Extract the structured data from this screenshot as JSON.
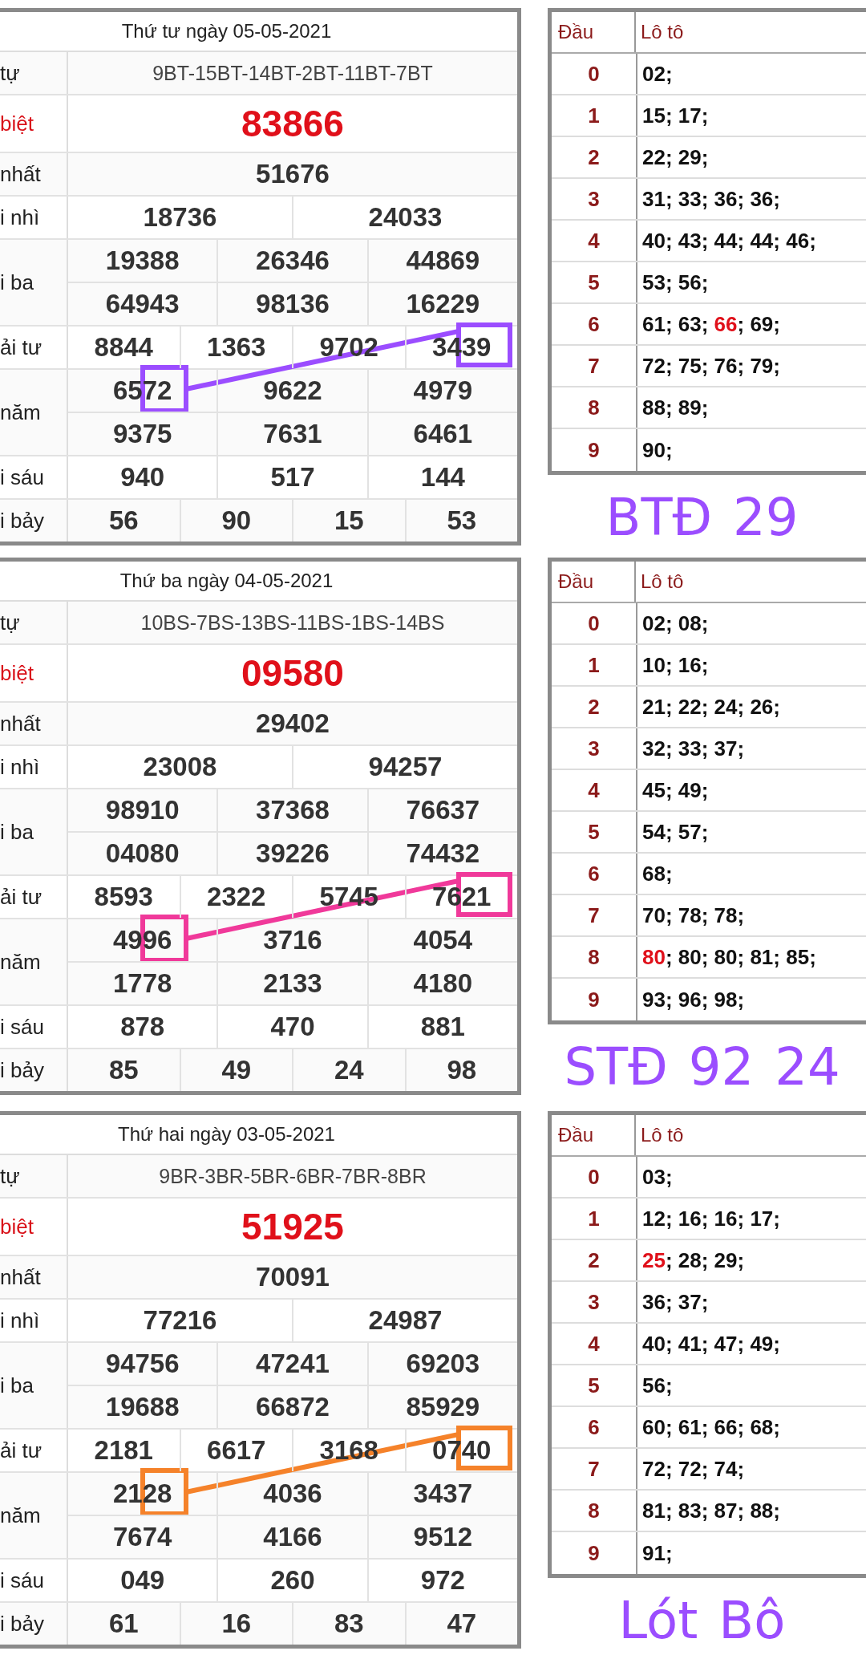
{
  "draws": [
    {
      "title": "Thứ tư ngày 05-05-2021",
      "notes": [
        "BTĐ",
        "29"
      ],
      "prizes": [
        {
          "kind": "series",
          "label": "tự",
          "lines": [
            [
              "9BT-15BT-14BT-2BT-11BT-7BT"
            ]
          ]
        },
        {
          "kind": "special",
          "label": "biệt",
          "lines": [
            [
              "83866"
            ]
          ]
        },
        {
          "kind": "normal",
          "label": "nhất",
          "lines": [
            [
              "51676"
            ]
          ]
        },
        {
          "kind": "normal",
          "label": "i nhì",
          "lines": [
            [
              "18736",
              "24033"
            ]
          ]
        },
        {
          "kind": "normal",
          "label": "i ba",
          "lines": [
            [
              "19388",
              "26346",
              "44869"
            ],
            [
              "64943",
              "98136",
              "16229"
            ]
          ]
        },
        {
          "kind": "normal",
          "label": "ải tư",
          "lines": [
            [
              "8844",
              "1363",
              "9702",
              "3439"
            ]
          ]
        },
        {
          "kind": "normal",
          "label": "năm",
          "lines": [
            [
              "6572",
              "9622",
              "4979"
            ],
            [
              "9375",
              "7631",
              "6461"
            ]
          ]
        },
        {
          "kind": "normal",
          "label": "i sáu",
          "lines": [
            [
              "940",
              "517",
              "144"
            ]
          ]
        },
        {
          "kind": "normal",
          "label": "i bảy",
          "lines": [
            [
              "56",
              "90",
              "15",
              "53"
            ]
          ]
        }
      ],
      "loto": {
        "head_label": "Đầu",
        "numbers_label": "Lô tô",
        "rows": [
          {
            "head": "0",
            "parts": [
              {
                "text": "02;",
                "hit": false
              }
            ]
          },
          {
            "head": "1",
            "parts": [
              {
                "text": "15; 17;",
                "hit": false
              }
            ]
          },
          {
            "head": "2",
            "parts": [
              {
                "text": "22; 29;",
                "hit": false
              }
            ]
          },
          {
            "head": "3",
            "parts": [
              {
                "text": "31; 33; 36; 36;",
                "hit": false
              }
            ]
          },
          {
            "head": "4",
            "parts": [
              {
                "text": "40; 43; 44; 44; 46;",
                "hit": false
              }
            ]
          },
          {
            "head": "5",
            "parts": [
              {
                "text": "53; 56;",
                "hit": false
              }
            ]
          },
          {
            "head": "6",
            "parts": [
              {
                "text": "61; 63; ",
                "hit": false
              },
              {
                "text": "66",
                "hit": true
              },
              {
                "text": "; 69;",
                "hit": false
              }
            ]
          },
          {
            "head": "7",
            "parts": [
              {
                "text": "72; 75; 76; 79;",
                "hit": false
              }
            ]
          },
          {
            "head": "8",
            "parts": [
              {
                "text": "88; 89;",
                "hit": false
              }
            ]
          },
          {
            "head": "9",
            "parts": [
              {
                "text": "90;",
                "hit": false
              }
            ]
          }
        ]
      }
    },
    {
      "title": "Thứ ba ngày 04-05-2021",
      "notes": [
        "STĐ",
        "92",
        "24"
      ],
      "prizes": [
        {
          "kind": "series",
          "label": "tự",
          "lines": [
            [
              "10BS-7BS-13BS-11BS-1BS-14BS"
            ]
          ]
        },
        {
          "kind": "special",
          "label": "biệt",
          "lines": [
            [
              "09580"
            ]
          ]
        },
        {
          "kind": "normal",
          "label": "nhất",
          "lines": [
            [
              "29402"
            ]
          ]
        },
        {
          "kind": "normal",
          "label": "i nhì",
          "lines": [
            [
              "23008",
              "94257"
            ]
          ]
        },
        {
          "kind": "normal",
          "label": "i ba",
          "lines": [
            [
              "98910",
              "37368",
              "76637"
            ],
            [
              "04080",
              "39226",
              "74432"
            ]
          ]
        },
        {
          "kind": "normal",
          "label": "ải tư",
          "lines": [
            [
              "8593",
              "2322",
              "5745",
              "7621"
            ]
          ]
        },
        {
          "kind": "normal",
          "label": "năm",
          "lines": [
            [
              "4996",
              "3716",
              "4054"
            ],
            [
              "1778",
              "2133",
              "4180"
            ]
          ]
        },
        {
          "kind": "normal",
          "label": "i sáu",
          "lines": [
            [
              "878",
              "470",
              "881"
            ]
          ]
        },
        {
          "kind": "normal",
          "label": "i bảy",
          "lines": [
            [
              "85",
              "49",
              "24",
              "98"
            ]
          ]
        }
      ],
      "loto": {
        "head_label": "Đầu",
        "numbers_label": "Lô tô",
        "rows": [
          {
            "head": "0",
            "parts": [
              {
                "text": "02; 08;",
                "hit": false
              }
            ]
          },
          {
            "head": "1",
            "parts": [
              {
                "text": "10; 16;",
                "hit": false
              }
            ]
          },
          {
            "head": "2",
            "parts": [
              {
                "text": "21; 22; 24; 26;",
                "hit": false
              }
            ]
          },
          {
            "head": "3",
            "parts": [
              {
                "text": "32; 33; 37;",
                "hit": false
              }
            ]
          },
          {
            "head": "4",
            "parts": [
              {
                "text": "45; 49;",
                "hit": false
              }
            ]
          },
          {
            "head": "5",
            "parts": [
              {
                "text": "54; 57;",
                "hit": false
              }
            ]
          },
          {
            "head": "6",
            "parts": [
              {
                "text": "68;",
                "hit": false
              }
            ]
          },
          {
            "head": "7",
            "parts": [
              {
                "text": "70; 78; 78;",
                "hit": false
              }
            ]
          },
          {
            "head": "8",
            "parts": [
              {
                "text": "80",
                "hit": true
              },
              {
                "text": "; 80; 80; 81; 85;",
                "hit": false
              }
            ]
          },
          {
            "head": "9",
            "parts": [
              {
                "text": "93; 96; 98;",
                "hit": false
              }
            ]
          }
        ]
      }
    },
    {
      "title": "Thứ hai ngày 03-05-2021",
      "notes": [
        "Lót",
        "Bô"
      ],
      "prizes": [
        {
          "kind": "series",
          "label": "tự",
          "lines": [
            [
              "9BR-3BR-5BR-6BR-7BR-8BR"
            ]
          ]
        },
        {
          "kind": "special",
          "label": "biệt",
          "lines": [
            [
              "51925"
            ]
          ]
        },
        {
          "kind": "normal",
          "label": "nhất",
          "lines": [
            [
              "70091"
            ]
          ]
        },
        {
          "kind": "normal",
          "label": "i nhì",
          "lines": [
            [
              "77216",
              "24987"
            ]
          ]
        },
        {
          "kind": "normal",
          "label": "i ba",
          "lines": [
            [
              "94756",
              "47241",
              "69203"
            ],
            [
              "19688",
              "66872",
              "85929"
            ]
          ]
        },
        {
          "kind": "normal",
          "label": "ải tư",
          "lines": [
            [
              "2181",
              "6617",
              "3168",
              "0740"
            ]
          ]
        },
        {
          "kind": "normal",
          "label": "năm",
          "lines": [
            [
              "2128",
              "4036",
              "3437"
            ],
            [
              "7674",
              "4166",
              "9512"
            ]
          ]
        },
        {
          "kind": "normal",
          "label": "i sáu",
          "lines": [
            [
              "049",
              "260",
              "972"
            ]
          ]
        },
        {
          "kind": "normal",
          "label": "i bảy",
          "lines": [
            [
              "61",
              "16",
              "83",
              "47"
            ]
          ]
        }
      ],
      "loto": {
        "head_label": "Đầu",
        "numbers_label": "Lô tô",
        "rows": [
          {
            "head": "0",
            "parts": [
              {
                "text": "03;",
                "hit": false
              }
            ]
          },
          {
            "head": "1",
            "parts": [
              {
                "text": "12; 16; 16; 17;",
                "hit": false
              }
            ]
          },
          {
            "head": "2",
            "parts": [
              {
                "text": "25",
                "hit": true
              },
              {
                "text": "; 28; 29;",
                "hit": false
              }
            ]
          },
          {
            "head": "3",
            "parts": [
              {
                "text": "36; 37;",
                "hit": false
              }
            ]
          },
          {
            "head": "4",
            "parts": [
              {
                "text": "40; 41; 47; 49;",
                "hit": false
              }
            ]
          },
          {
            "head": "5",
            "parts": [
              {
                "text": "56;",
                "hit": false
              }
            ]
          },
          {
            "head": "6",
            "parts": [
              {
                "text": "60; 61; 66; 68;",
                "hit": false
              }
            ]
          },
          {
            "head": "7",
            "parts": [
              {
                "text": "72; 72; 74;",
                "hit": false
              }
            ]
          },
          {
            "head": "8",
            "parts": [
              {
                "text": "81; 83; 87; 88;",
                "hit": false
              }
            ]
          },
          {
            "head": "9",
            "parts": [
              {
                "text": "91;",
                "hit": false
              }
            ]
          }
        ]
      }
    }
  ]
}
